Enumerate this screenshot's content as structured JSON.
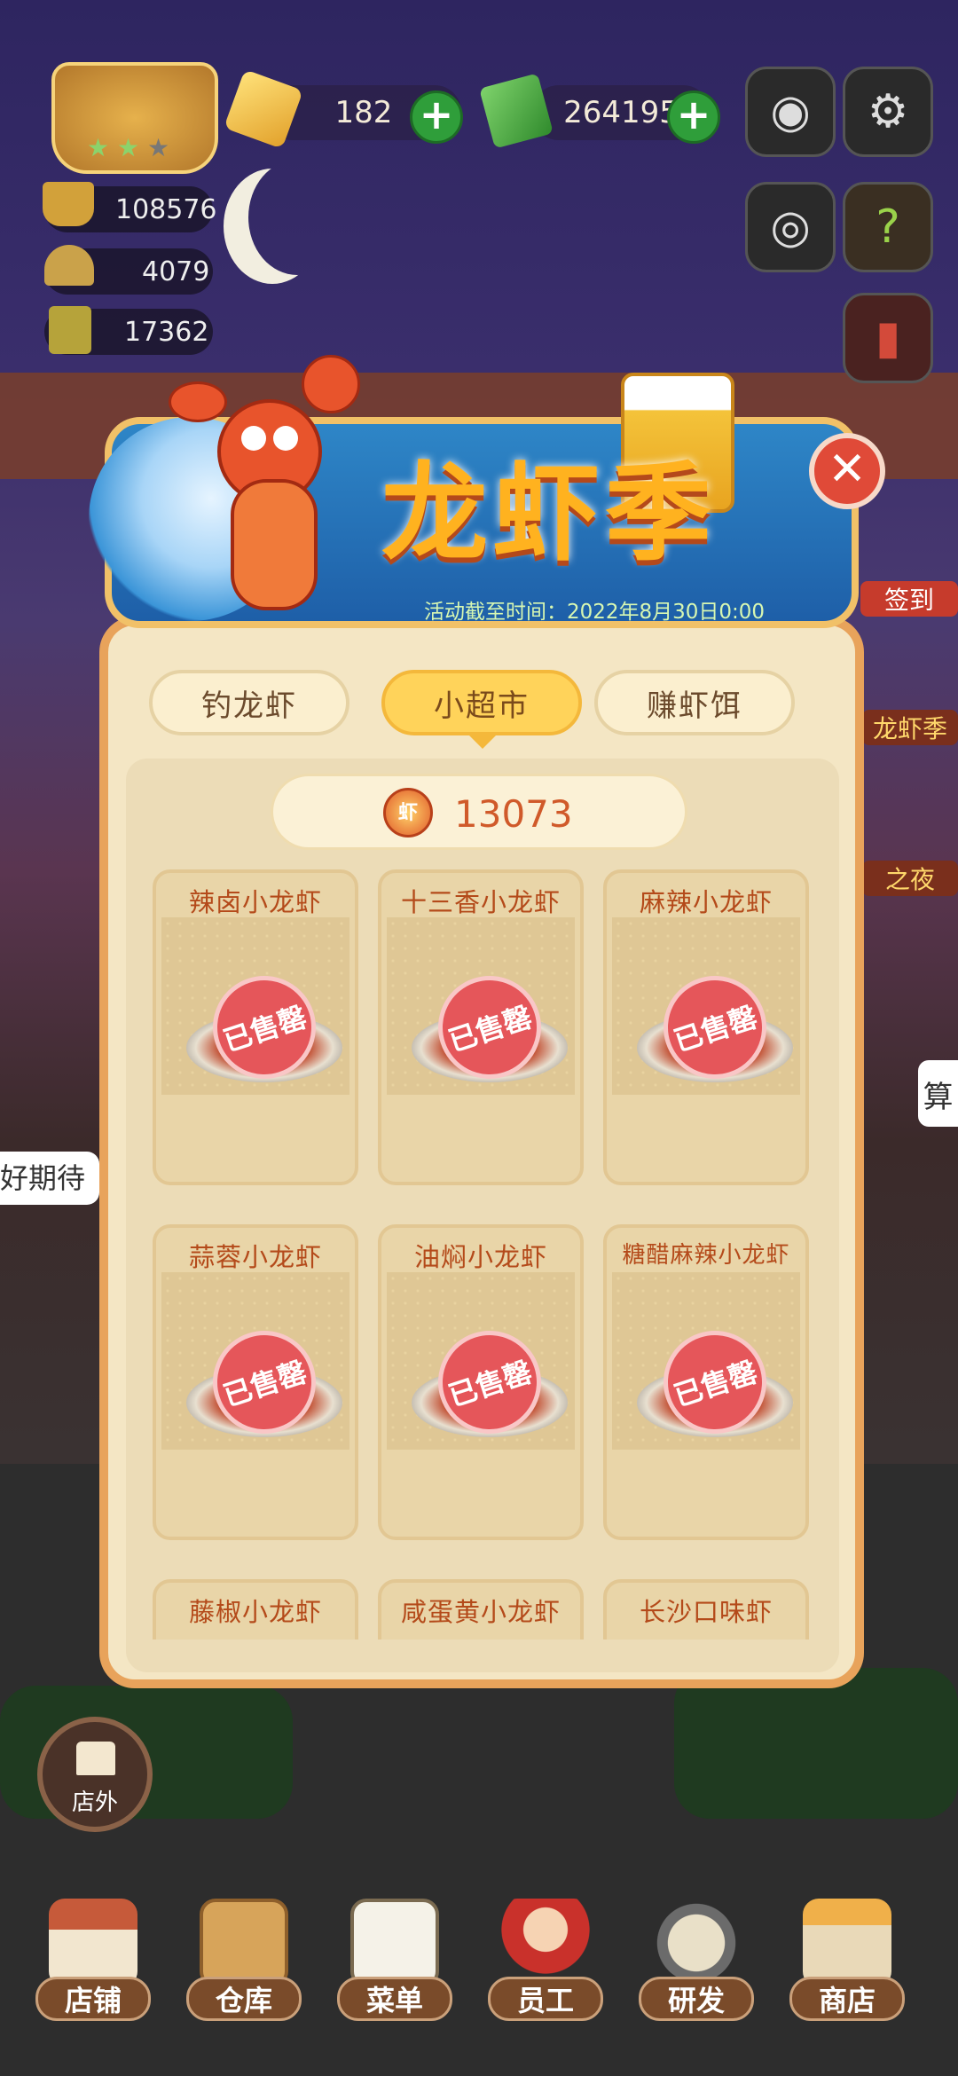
{
  "hud": {
    "gems": "182",
    "cash": "264195",
    "stat1": "108576",
    "stat2": "4079",
    "stat3": "17362",
    "plus_label": "+"
  },
  "event": {
    "title": "龙虾季",
    "deadline": "活动截至时间：2022年8月30日0:00",
    "close_label": "✕"
  },
  "tabs": [
    {
      "label": "钓龙虾"
    },
    {
      "label": "小超市"
    },
    {
      "label": "赚虾饵"
    }
  ],
  "currency": {
    "amount": "13073",
    "coin_glyph": "虾"
  },
  "products": [
    {
      "name": "辣卤小龙虾",
      "status": "已售罄"
    },
    {
      "name": "十三香小龙虾",
      "status": "已售罄"
    },
    {
      "name": "麻辣小龙虾",
      "status": "已售罄"
    },
    {
      "name": "蒜蓉小龙虾",
      "status": "已售罄"
    },
    {
      "name": "油焖小龙虾",
      "status": "已售罄"
    },
    {
      "name": "糖醋麻辣小龙虾",
      "status": "已售罄"
    },
    {
      "name": "藤椒小龙虾"
    },
    {
      "name": "咸蛋黄小龙虾"
    },
    {
      "name": "长沙口味虾"
    }
  ],
  "side": {
    "label1": "龙虾季",
    "label2": "之夜",
    "label3": "签到",
    "speech_right": "算",
    "speech_left": "好期待"
  },
  "outside_button": {
    "label": "店外"
  },
  "nav": [
    {
      "label": "店铺"
    },
    {
      "label": "仓库"
    },
    {
      "label": "菜单"
    },
    {
      "label": "员工"
    },
    {
      "label": "研发"
    },
    {
      "label": "商店"
    }
  ],
  "icons": [
    "camera-icon",
    "gear-icon",
    "eye-icon",
    "guide-book-icon",
    "red-book-icon",
    "close-icon",
    "shop-icon"
  ],
  "colors": {
    "accent": "#ffd35a",
    "stamp": "#e5565a",
    "frame": "#e8a35b",
    "plus": "#2f9e3a"
  }
}
